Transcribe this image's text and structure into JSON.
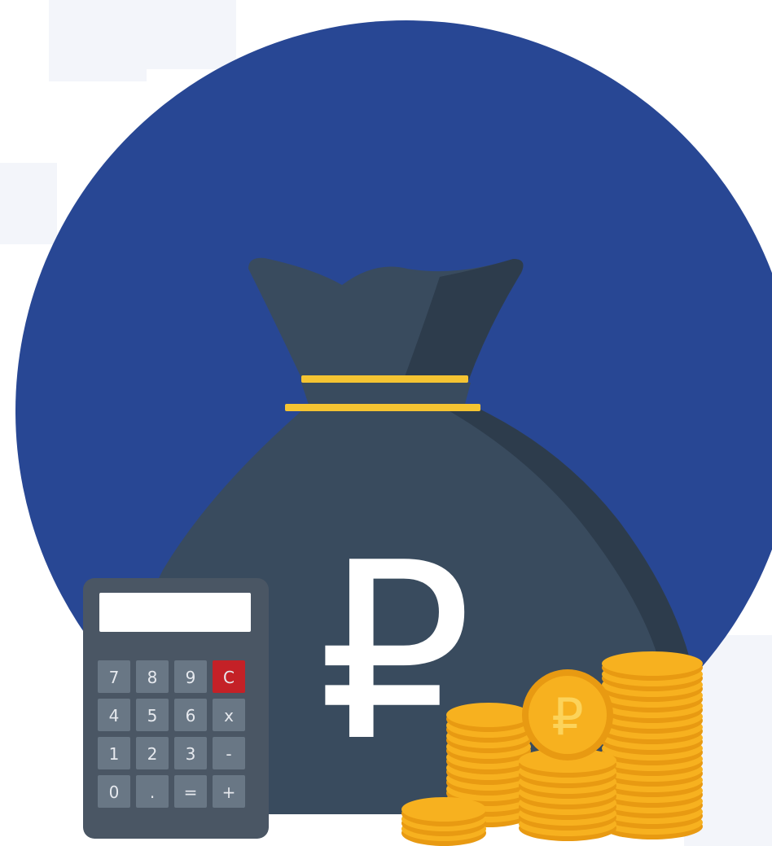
{
  "colors": {
    "background": "#ffffff",
    "tile": "#f3f5fa",
    "circle": "#284794",
    "bag_main": "#394b5e",
    "bag_shadow": "#2d3c4c",
    "band": "#f5c432",
    "currency_symbol": "#ffffff",
    "calculator_body": "#4a5664",
    "calculator_screen": "#ffffff",
    "calculator_key": "#697785",
    "calculator_clear_key": "#c42127",
    "coin_face": "#f7b11f",
    "coin_edge": "#e89a12",
    "coin_highlight": "#fcd35a"
  },
  "illustration": {
    "bag_symbol": "₽",
    "coin_symbol": "₽",
    "calculator_keys": [
      [
        "7",
        "8",
        "9",
        "C"
      ],
      [
        "4",
        "5",
        "6",
        "x"
      ],
      [
        "1",
        "2",
        "3",
        "-"
      ],
      [
        "0",
        ".",
        "=",
        "+"
      ]
    ],
    "icons": [
      "money-bag-icon",
      "ruble-icon",
      "calculator-icon",
      "coin-stack-icon"
    ]
  }
}
